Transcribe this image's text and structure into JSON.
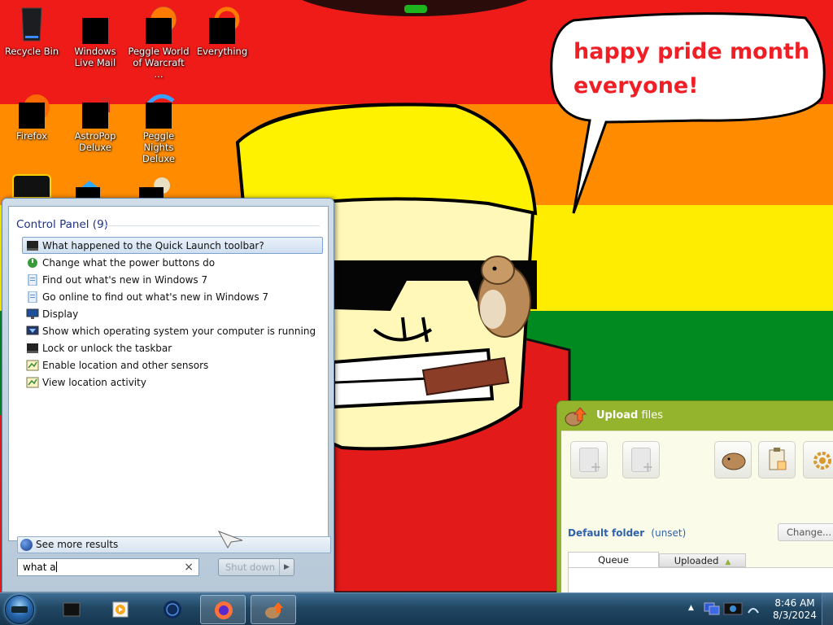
{
  "desktop": {
    "icons": [
      {
        "label": "Recycle Bin"
      },
      {
        "label": "Windows Live Mail"
      },
      {
        "label": "Peggle World of Warcraft ..."
      },
      {
        "label": "Everything"
      },
      {
        "label": "Firefox"
      },
      {
        "label": "AstroPop Deluxe"
      },
      {
        "label": "Peggle Nights Deluxe"
      }
    ],
    "wallpaper_text": "happy pride month everyone!"
  },
  "start_menu": {
    "section_title": "Control Panel (9)",
    "results": [
      {
        "label": "What happened to the Quick Launch toolbar?",
        "icon": "taskbar-icon",
        "selected": true
      },
      {
        "label": "Change what the power buttons do",
        "icon": "power-icon"
      },
      {
        "label": "Find out what's new in Windows 7",
        "icon": "help-doc-icon"
      },
      {
        "label": "Go online to find out what's new in Windows 7",
        "icon": "help-doc-icon"
      },
      {
        "label": "Display",
        "icon": "display-icon"
      },
      {
        "label": "Show which operating system your computer is running",
        "icon": "system-icon"
      },
      {
        "label": "Lock or unlock the taskbar",
        "icon": "taskbar-icon"
      },
      {
        "label": "Enable location and other sensors",
        "icon": "sensor-icon"
      },
      {
        "label": "View location activity",
        "icon": "sensor-icon"
      }
    ],
    "see_more": "See more results",
    "search_value": "what a",
    "shutdown_label": "Shut down"
  },
  "upload_window": {
    "title_bold": "Upload",
    "title_rest": " files",
    "default_folder_label": "Default folder",
    "default_folder_value": "(unset)",
    "change_button": "Change...",
    "tabs": [
      "Queue",
      "Uploaded"
    ]
  },
  "taskbar": {
    "time": "8:46 AM",
    "date": "8/3/2024"
  },
  "colors": {
    "stripe_red": "#ee1b18",
    "stripe_orange": "#ff8c00",
    "stripe_yellow": "#ffed00",
    "stripe_green": "#008a1f",
    "uploader_green": "#95b42d",
    "selection_text": "#1e3287"
  }
}
